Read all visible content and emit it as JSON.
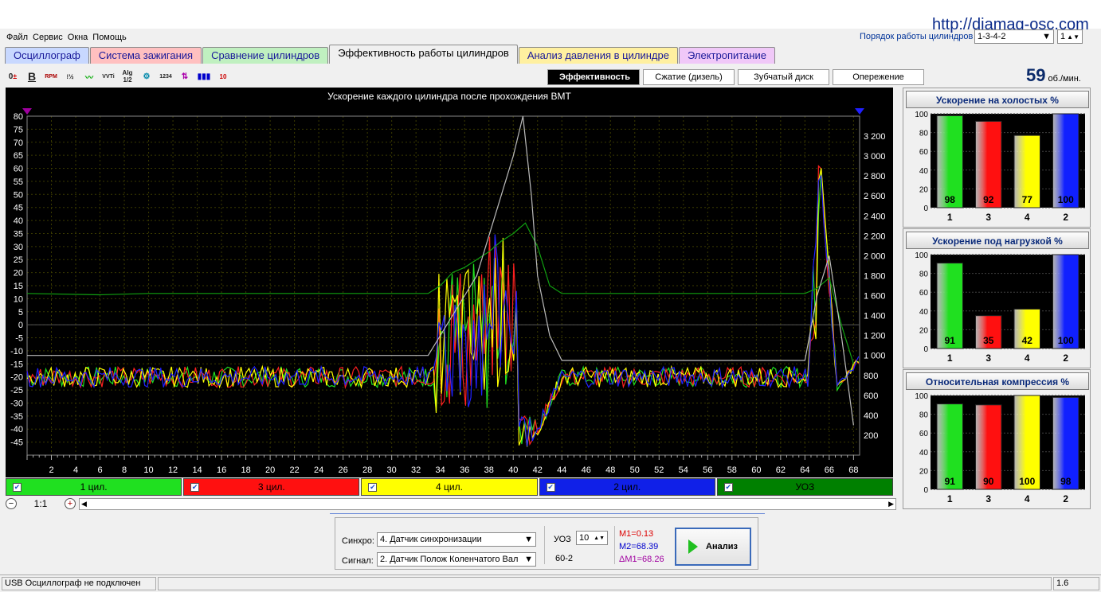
{
  "url": "http://diamag-osc.com",
  "menu": [
    "Файл",
    "Сервис",
    "Окна",
    "Помощь"
  ],
  "firing_order": {
    "label": "Порядок работы цилиндров",
    "value": "1-3-4-2",
    "index": "1"
  },
  "tabs": [
    {
      "label": "Осциллограф",
      "color": "#c8d8ff"
    },
    {
      "label": "Система зажигания",
      "color": "#ffc0c0"
    },
    {
      "label": "Сравнение цилиндров",
      "color": "#c0f0c0"
    },
    {
      "label": "Эффективность работы цилиндров",
      "color": "#f0f0f0",
      "active": true
    },
    {
      "label": "Анализ давления в цилиндре",
      "color": "#fff0a0"
    },
    {
      "label": "Электропитание",
      "color": "#f0c8f8"
    }
  ],
  "subtabs": [
    "Эффективность",
    "Сжатие (дизель)",
    "Зубчатый диск",
    "Опережение"
  ],
  "rpm": {
    "value": "59",
    "unit": "об./мин."
  },
  "toolbar_icons": [
    "offset-icon",
    "bold-icon",
    "rpm-icon",
    "scale-icon",
    "curve-icon",
    "vvti-icon",
    "algorithm-icon",
    "sensor-icon",
    "numbers-icon",
    "markers-icon",
    "bars-icon",
    "cylinder-icon"
  ],
  "toolbar_text": {
    "rpm": "RPM",
    "alg": "Alg",
    "half": "1/2",
    "vvt": "VVTi",
    "num": "1234",
    "ten": "10"
  },
  "chart_data": {
    "type": "line",
    "title": "Ускорение каждого цилиндра после прохождения ВМТ",
    "xlim": [
      0,
      68.5
    ],
    "x_ticks": [
      2,
      4,
      6,
      8,
      10,
      12,
      14,
      16,
      18,
      20,
      22,
      24,
      26,
      28,
      30,
      32,
      34,
      36,
      38,
      40,
      42,
      44,
      46,
      48,
      50,
      52,
      54,
      56,
      58,
      60,
      62,
      64,
      66,
      68
    ],
    "ylim_left": [
      -50,
      80
    ],
    "y_ticks_left": [
      80,
      75,
      70,
      65,
      60,
      55,
      50,
      45,
      40,
      35,
      30,
      25,
      20,
      15,
      10,
      5,
      0,
      -5,
      -10,
      -15,
      -20,
      -25,
      -30,
      -35,
      -40,
      -45
    ],
    "ylim_right": [
      0,
      3400
    ],
    "y_ticks_right": [
      "3 200",
      "3 000",
      "2 800",
      "2 600",
      "2 400",
      "2 200",
      "2 000",
      "1 800",
      "1 600",
      "1 400",
      "1 200",
      "1 000",
      "800",
      "600",
      "400",
      "200"
    ],
    "y_ticks_right_values": [
      3200,
      3000,
      2800,
      2600,
      2400,
      2200,
      2000,
      1800,
      1600,
      1400,
      1200,
      1000,
      800,
      600,
      400,
      200
    ],
    "grid": true,
    "series": [
      {
        "name": "1 цил.",
        "color": "#20e020",
        "axis": "left"
      },
      {
        "name": "3 цил.",
        "color": "#ff2020",
        "axis": "left"
      },
      {
        "name": "4 цил.",
        "color": "#ffff00",
        "axis": "left"
      },
      {
        "name": "2 цил.",
        "color": "#2020ff",
        "axis": "left"
      },
      {
        "name": "УОЗ",
        "color": "#008000",
        "axis": "left"
      }
    ],
    "uoz_curve": [
      [
        0,
        12
      ],
      [
        6,
        11.5
      ],
      [
        10,
        12
      ],
      [
        16,
        12
      ],
      [
        20,
        12
      ],
      [
        26,
        12
      ],
      [
        30,
        12
      ],
      [
        33,
        12
      ],
      [
        34,
        15
      ],
      [
        35,
        20
      ],
      [
        36,
        22
      ],
      [
        37,
        25
      ],
      [
        38,
        28
      ],
      [
        39,
        32
      ],
      [
        40,
        35
      ],
      [
        41,
        39
      ],
      [
        42,
        30
      ],
      [
        43,
        15
      ],
      [
        44,
        12
      ],
      [
        50,
        12
      ],
      [
        56,
        12
      ],
      [
        60,
        12
      ],
      [
        64,
        12
      ],
      [
        65,
        14
      ],
      [
        66,
        18
      ],
      [
        67,
        0
      ],
      [
        68,
        -15
      ]
    ],
    "rpm_curve": [
      [
        0,
        1000
      ],
      [
        10,
        1000
      ],
      [
        20,
        1000
      ],
      [
        30,
        1000
      ],
      [
        33,
        1000
      ],
      [
        34,
        1200
      ],
      [
        35,
        1400
      ],
      [
        36,
        1600
      ],
      [
        37,
        1800
      ],
      [
        38,
        2200
      ],
      [
        39,
        2600
      ],
      [
        40,
        3000
      ],
      [
        40.8,
        3400
      ],
      [
        41.5,
        2600
      ],
      [
        42,
        1800
      ],
      [
        43,
        1200
      ],
      [
        44,
        950
      ],
      [
        50,
        950
      ],
      [
        60,
        950
      ],
      [
        64,
        950
      ],
      [
        65,
        1600
      ],
      [
        66,
        2000
      ],
      [
        67,
        1200
      ],
      [
        68,
        300
      ]
    ],
    "noise_baseline": -20,
    "noise_amplitude": 4,
    "burst_region": [
      33.5,
      42
    ],
    "spike_region": [
      64.3,
      66.5
    ]
  },
  "legend": [
    {
      "label": "1 цил.",
      "bg": "#20e020"
    },
    {
      "label": "3 цил.",
      "bg": "#ff1010"
    },
    {
      "label": "4 цил.",
      "bg": "#ffff00"
    },
    {
      "label": "2 цил.",
      "bg": "#1020e8"
    },
    {
      "label": "УОЗ",
      "bg": "#008000"
    }
  ],
  "zoom": "1:1",
  "bar_charts": [
    {
      "title": "Ускорение на холостых %",
      "categories": [
        "1",
        "3",
        "4",
        "2"
      ],
      "values": [
        98,
        92,
        77,
        100
      ],
      "colors": [
        "#20e020",
        "#ff1010",
        "#ffff00",
        "#1020ff"
      ],
      "y_ticks": [
        100,
        80,
        60,
        40,
        20,
        0
      ]
    },
    {
      "title": "Ускорение под нагрузкой %",
      "categories": [
        "1",
        "3",
        "4",
        "2"
      ],
      "values": [
        91,
        35,
        42,
        100
      ],
      "colors": [
        "#20e020",
        "#ff1010",
        "#ffff00",
        "#1020ff"
      ],
      "y_ticks": [
        100,
        80,
        60,
        40,
        20,
        0
      ]
    },
    {
      "title": "Относительная компрессия %",
      "categories": [
        "1",
        "3",
        "4",
        "2"
      ],
      "values": [
        91,
        90,
        100,
        98
      ],
      "colors": [
        "#20e020",
        "#ff1010",
        "#ffff00",
        "#1020ff"
      ],
      "y_ticks": [
        100,
        80,
        60,
        40,
        20,
        0
      ]
    }
  ],
  "bottom": {
    "sync_label": "Синхро:",
    "sync_value": "4.  Датчик синхронизации",
    "signal_label": "Сигнал:",
    "signal_value": "2.  Датчик Полож Коленчатого Вал",
    "uoz_label": "УОЗ",
    "uoz_value": "10",
    "wheel": "60-2",
    "m1": "M1=0.13",
    "m2": "M2=68.39",
    "dm": "ΔM1=68.26",
    "analyze": "Анализ"
  },
  "status": {
    "left": "USB Осциллограф не подключен",
    "right": "1.6"
  }
}
